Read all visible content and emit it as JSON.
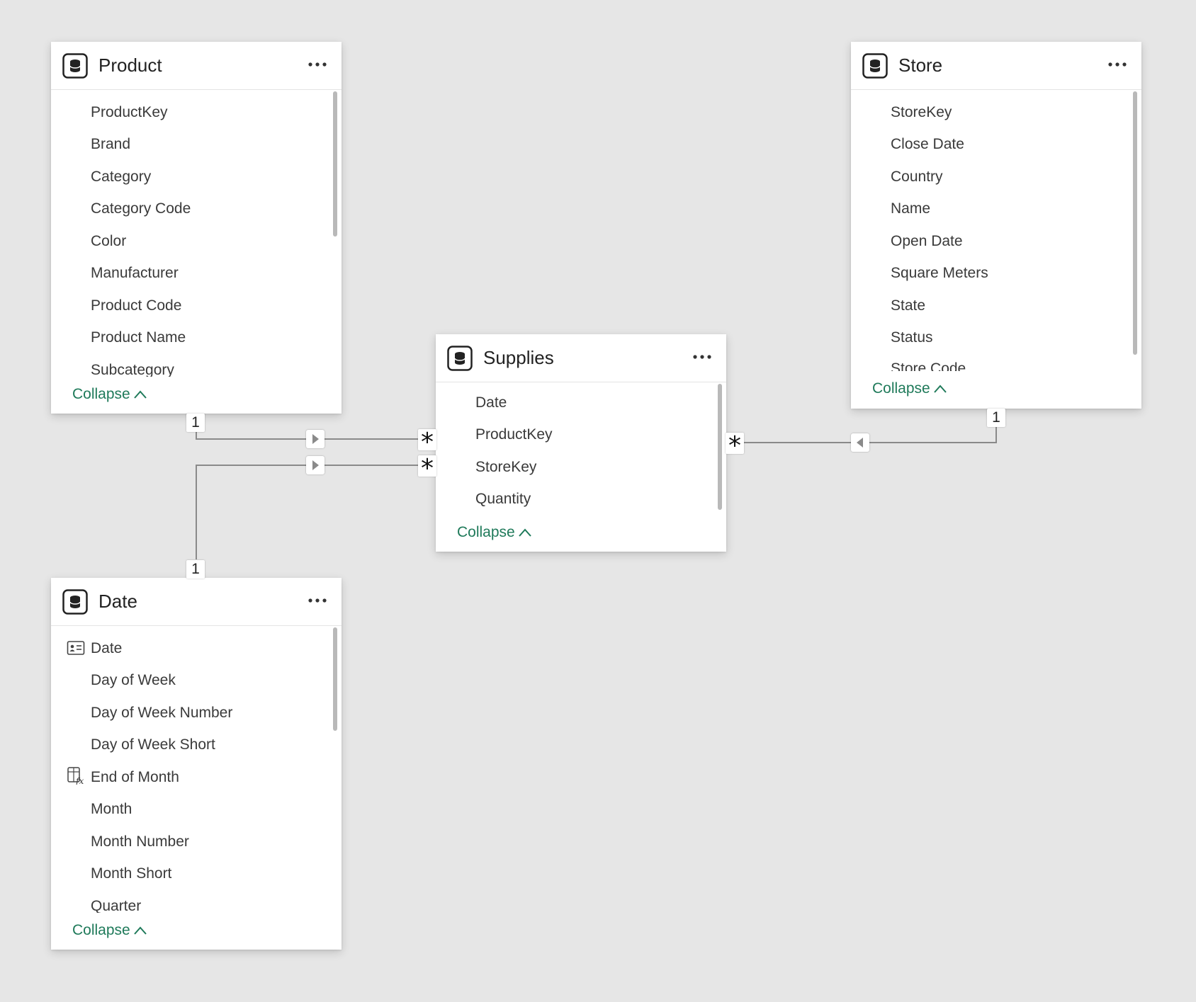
{
  "tables": {
    "product": {
      "title": "Product",
      "fields": [
        "ProductKey",
        "Brand",
        "Category",
        "Category Code",
        "Color",
        "Manufacturer",
        "Product Code",
        "Product Name",
        "Subcategory"
      ],
      "collapse_label": "Collapse",
      "icon": "table-icon"
    },
    "store": {
      "title": "Store",
      "fields": [
        "StoreKey",
        "Close Date",
        "Country",
        "Name",
        "Open Date",
        "Square Meters",
        "State",
        "Status",
        "Store Code"
      ],
      "collapse_label": "Collapse",
      "icon": "table-icon"
    },
    "supplies": {
      "title": "Supplies",
      "fields": [
        "Date",
        "ProductKey",
        "StoreKey",
        "Quantity"
      ],
      "collapse_label": "Collapse",
      "icon": "table-icon"
    },
    "date": {
      "title": "Date",
      "fields": [
        "Date",
        "Day of Week",
        "Day of Week Number",
        "Day of Week Short",
        "End of Month",
        "Month",
        "Month Number",
        "Month Short",
        "Quarter"
      ],
      "field_icons": {
        "0": "date-key-icon",
        "4": "calculated-column-icon"
      },
      "collapse_label": "Collapse",
      "icon": "table-icon"
    }
  },
  "relationships": [
    {
      "from": "Product",
      "to": "Supplies",
      "from_cardinality": "1",
      "to_cardinality": "*"
    },
    {
      "from": "Date",
      "to": "Supplies",
      "from_cardinality": "1",
      "to_cardinality": "*"
    },
    {
      "from": "Store",
      "to": "Supplies",
      "from_cardinality": "1",
      "to_cardinality": "*"
    }
  ],
  "colors": {
    "background": "#e6e6e6",
    "accent": "#1f7a5a",
    "line": "#8a8a8a"
  }
}
